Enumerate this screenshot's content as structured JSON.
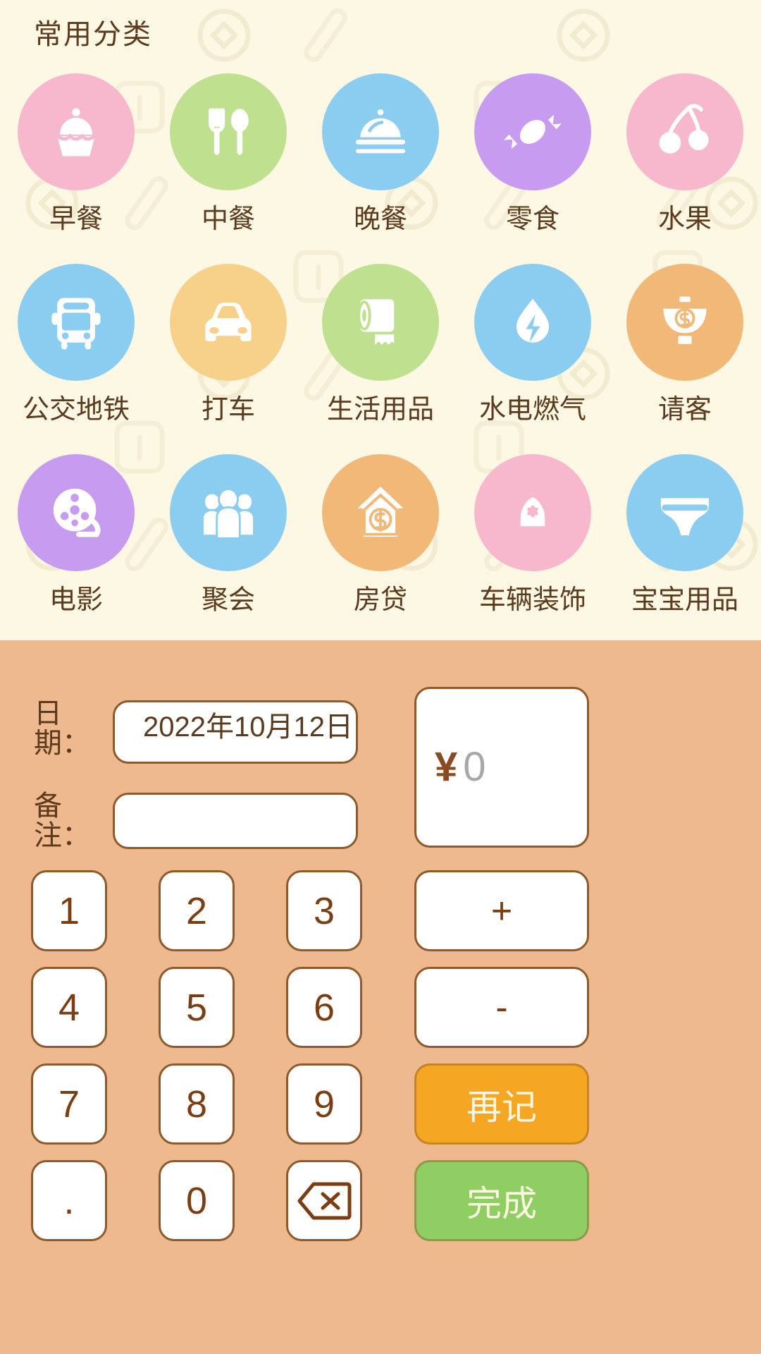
{
  "theme": {
    "panel_bg": "#FCF8E4",
    "keypad_bg": "#EEB98E",
    "text_brown": "#5B3A1E",
    "key_border": "#8C5A2B",
    "accent_orange": "#F5A623",
    "accent_green": "#8FCE62",
    "currency_color": "#8C4A1E",
    "placeholder_gray": "#A8A8A8"
  },
  "category_panel": {
    "title": "常用分类",
    "rows": [
      [
        {
          "label": "早餐",
          "icon": "cupcake-icon",
          "circle": "#F7B8CE",
          "ink": "#FFFFFF"
        },
        {
          "label": "中餐",
          "icon": "fork-spoon-icon",
          "circle": "#BFE08F",
          "ink": "#FFFFFF"
        },
        {
          "label": "晚餐",
          "icon": "cloche-icon",
          "circle": "#8BCDF0",
          "ink": "#FFFFFF"
        },
        {
          "label": "零食",
          "icon": "candy-icon",
          "circle": "#C79BF0",
          "ink": "#FFFFFF"
        },
        {
          "label": "水果",
          "icon": "cherry-icon",
          "circle": "#F7B8CE",
          "ink": "#FFFFFF"
        }
      ],
      [
        {
          "label": "公交地铁",
          "icon": "bus-icon",
          "circle": "#8BCDF0",
          "ink": "#FFFFFF"
        },
        {
          "label": "打车",
          "icon": "car-icon",
          "circle": "#F7D189",
          "ink": "#FFFFFF"
        },
        {
          "label": "生活用品",
          "icon": "toilet-paper-icon",
          "circle": "#BFE08F",
          "ink": "#FFFFFF"
        },
        {
          "label": "水电燃气",
          "icon": "water-power-icon",
          "circle": "#8BCDF0",
          "ink": "#FFFFFF"
        },
        {
          "label": "请客",
          "icon": "treat-bowl-icon",
          "circle": "#F2B878",
          "ink": "#FFFFFF"
        }
      ],
      [
        {
          "label": "电影",
          "icon": "film-reel-icon",
          "circle": "#C79BF0",
          "ink": "#FFFFFF"
        },
        {
          "label": "聚会",
          "icon": "people-group-icon",
          "circle": "#8BCDF0",
          "ink": "#FFFFFF"
        },
        {
          "label": "房贷",
          "icon": "house-money-icon",
          "circle": "#F2B878",
          "ink": "#FFFFFF"
        },
        {
          "label": "车辆装饰",
          "icon": "car-decor-icon",
          "circle": "#F7B8CE",
          "ink": "#FFFFFF"
        },
        {
          "label": "宝宝用品",
          "icon": "diaper-icon",
          "circle": "#8BCDF0",
          "ink": "#FFFFFF"
        }
      ]
    ]
  },
  "form": {
    "date_label": "日期：",
    "date_value": "2022年10月12日",
    "note_label": "备注：",
    "note_value": "",
    "note_placeholder": "",
    "amount_currency": "¥",
    "amount_value": "0"
  },
  "keypad": {
    "keys": [
      {
        "label": "1",
        "name": "key-1"
      },
      {
        "label": "2",
        "name": "key-2"
      },
      {
        "label": "3",
        "name": "key-3"
      },
      {
        "label": "4",
        "name": "key-4"
      },
      {
        "label": "5",
        "name": "key-5"
      },
      {
        "label": "6",
        "name": "key-6"
      },
      {
        "label": "7",
        "name": "key-7"
      },
      {
        "label": "8",
        "name": "key-8"
      },
      {
        "label": "9",
        "name": "key-9"
      },
      {
        "label": ".",
        "name": "key-decimal"
      },
      {
        "label": "0",
        "name": "key-0"
      },
      {
        "label": "",
        "name": "key-backspace",
        "icon": "backspace-icon"
      }
    ],
    "actions": [
      {
        "label": "+",
        "name": "key-plus",
        "style": "plain"
      },
      {
        "label": "-",
        "name": "key-minus",
        "style": "plain"
      },
      {
        "label": "再记",
        "name": "save-and-continue-button",
        "style": "orange"
      },
      {
        "label": "完成",
        "name": "done-button",
        "style": "green"
      }
    ]
  }
}
